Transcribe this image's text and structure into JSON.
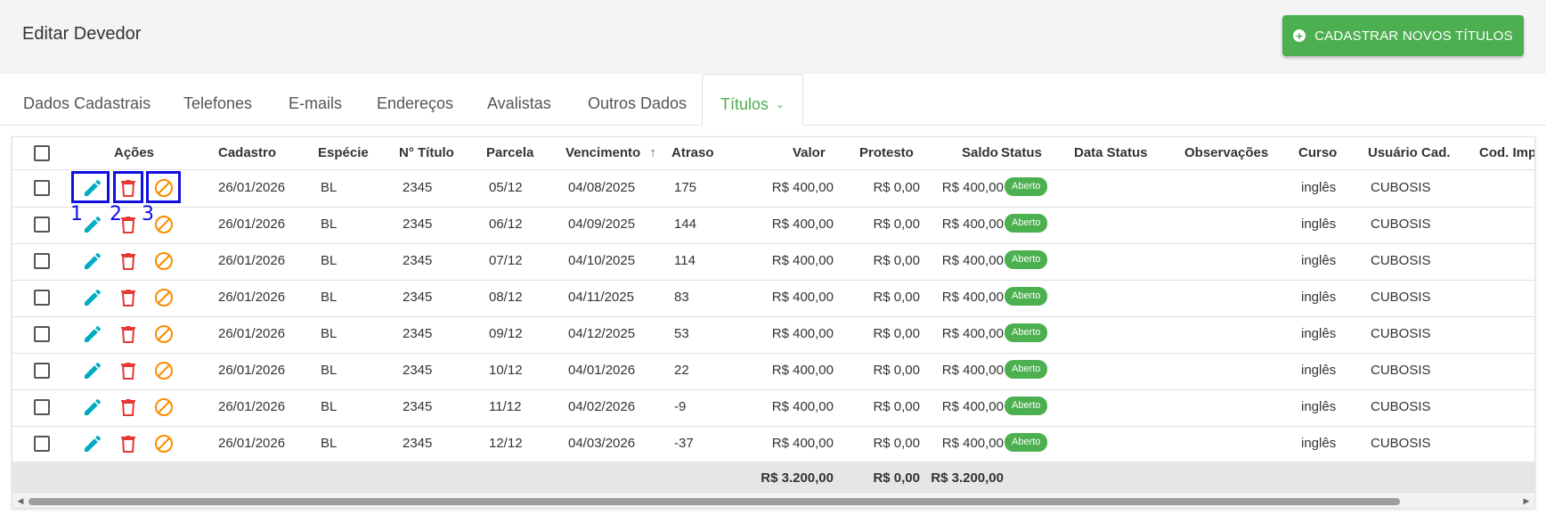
{
  "header": {
    "title": "Editar Devedor",
    "new_button_label": "CADASTRAR NOVOS TÍTULOS",
    "new_button_icon": "plus-circle-icon"
  },
  "tabs": [
    {
      "label": "Dados Cadastrais"
    },
    {
      "label": "Telefones"
    },
    {
      "label": "E-mails"
    },
    {
      "label": "Endereços"
    },
    {
      "label": "Avalistas"
    },
    {
      "label": "Outros Dados"
    },
    {
      "label": "Títulos",
      "active": true
    }
  ],
  "table": {
    "columns": {
      "acoes": "Ações",
      "cadastro": "Cadastro",
      "especie": "Espécie",
      "titulo": "N° Título",
      "parcela": "Parcela",
      "vencimento": "Vencimento",
      "atraso": "Atraso",
      "valor": "Valor",
      "protesto": "Protesto",
      "saldo": "Saldo",
      "status": "Status",
      "data_status": "Data Status",
      "observacoes": "Observações",
      "curso": "Curso",
      "usuario": "Usuário Cad.",
      "cod": "Cod. Imp"
    },
    "rows": [
      {
        "cadastro": "26/01/2026",
        "especie": "BL",
        "titulo": "2345",
        "parcela": "05/12",
        "vencimento": "04/08/2025",
        "atraso": "175",
        "valor": "R$ 400,00",
        "protesto": "R$ 0,00",
        "saldo": "R$ 400,00",
        "status": "Aberto",
        "curso": "inglês",
        "usuario": "CUBOSIS"
      },
      {
        "cadastro": "26/01/2026",
        "especie": "BL",
        "titulo": "2345",
        "parcela": "06/12",
        "vencimento": "04/09/2025",
        "atraso": "144",
        "valor": "R$ 400,00",
        "protesto": "R$ 0,00",
        "saldo": "R$ 400,00",
        "status": "Aberto",
        "curso": "inglês",
        "usuario": "CUBOSIS"
      },
      {
        "cadastro": "26/01/2026",
        "especie": "BL",
        "titulo": "2345",
        "parcela": "07/12",
        "vencimento": "04/10/2025",
        "atraso": "114",
        "valor": "R$ 400,00",
        "protesto": "R$ 0,00",
        "saldo": "R$ 400,00",
        "status": "Aberto",
        "curso": "inglês",
        "usuario": "CUBOSIS"
      },
      {
        "cadastro": "26/01/2026",
        "especie": "BL",
        "titulo": "2345",
        "parcela": "08/12",
        "vencimento": "04/11/2025",
        "atraso": "83",
        "valor": "R$ 400,00",
        "protesto": "R$ 0,00",
        "saldo": "R$ 400,00",
        "status": "Aberto",
        "curso": "inglês",
        "usuario": "CUBOSIS"
      },
      {
        "cadastro": "26/01/2026",
        "especie": "BL",
        "titulo": "2345",
        "parcela": "09/12",
        "vencimento": "04/12/2025",
        "atraso": "53",
        "valor": "R$ 400,00",
        "protesto": "R$ 0,00",
        "saldo": "R$ 400,00",
        "status": "Aberto",
        "curso": "inglês",
        "usuario": "CUBOSIS"
      },
      {
        "cadastro": "26/01/2026",
        "especie": "BL",
        "titulo": "2345",
        "parcela": "10/12",
        "vencimento": "04/01/2026",
        "atraso": "22",
        "valor": "R$ 400,00",
        "protesto": "R$ 0,00",
        "saldo": "R$ 400,00",
        "status": "Aberto",
        "curso": "inglês",
        "usuario": "CUBOSIS"
      },
      {
        "cadastro": "26/01/2026",
        "especie": "BL",
        "titulo": "2345",
        "parcela": "11/12",
        "vencimento": "04/02/2026",
        "atraso": "-9",
        "valor": "R$ 400,00",
        "protesto": "R$ 0,00",
        "saldo": "R$ 400,00",
        "status": "Aberto",
        "curso": "inglês",
        "usuario": "CUBOSIS"
      },
      {
        "cadastro": "26/01/2026",
        "especie": "BL",
        "titulo": "2345",
        "parcela": "12/12",
        "vencimento": "04/03/2026",
        "atraso": "-37",
        "valor": "R$ 400,00",
        "protesto": "R$ 0,00",
        "saldo": "R$ 400,00",
        "status": "Aberto",
        "curso": "inglês",
        "usuario": "CUBOSIS"
      }
    ],
    "totals": {
      "valor": "R$ 3.200,00",
      "protesto": "R$ 0,00",
      "saldo": "R$ 3.200,00"
    },
    "sort_indicator": "arrow-up-icon"
  },
  "annotations": [
    "1",
    "2",
    "3"
  ],
  "colors": {
    "accent": "#4caf50",
    "edit": "#00acc1",
    "delete": "#e53935",
    "cancel": "#fb8c00",
    "highlight": "#1010e0"
  }
}
